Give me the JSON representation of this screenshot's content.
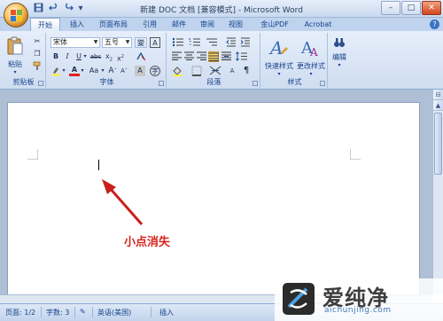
{
  "window": {
    "title": "新建 DOC 文档 [兼容模式] - Microsoft Word",
    "qat_icons": [
      "save-icon",
      "undo-icon",
      "redo-icon"
    ],
    "controls": [
      "minimize-icon",
      "maximize-icon",
      "close-icon"
    ]
  },
  "tabs": [
    "开始",
    "插入",
    "页面布局",
    "引用",
    "邮件",
    "审阅",
    "视图",
    "金山PDF",
    "Acrobat"
  ],
  "active_tab": "开始",
  "ribbon": {
    "clipboard": {
      "paste_label": "粘贴",
      "group_label": "剪贴板"
    },
    "font": {
      "font_name": "宋体",
      "font_size": "五号",
      "group_label": "字体"
    },
    "paragraph": {
      "group_label": "段落"
    },
    "styles": {
      "quick_styles": "快速样式",
      "change_styles": "更改样式",
      "group_label": "样式"
    },
    "editing": {
      "label": "编辑"
    }
  },
  "document": {
    "annotation_text": "小点消失"
  },
  "statusbar": {
    "page": "页面: 1/2",
    "words": "字数: 3",
    "language": "英语(美国)",
    "mode": "插入"
  },
  "watermark": {
    "title": "爱纯净",
    "url": "aichunjing.com"
  },
  "colors": {
    "annotation": "#d9231b",
    "ribbon_bg": "#dbe6f4",
    "accent": "#15428b"
  }
}
